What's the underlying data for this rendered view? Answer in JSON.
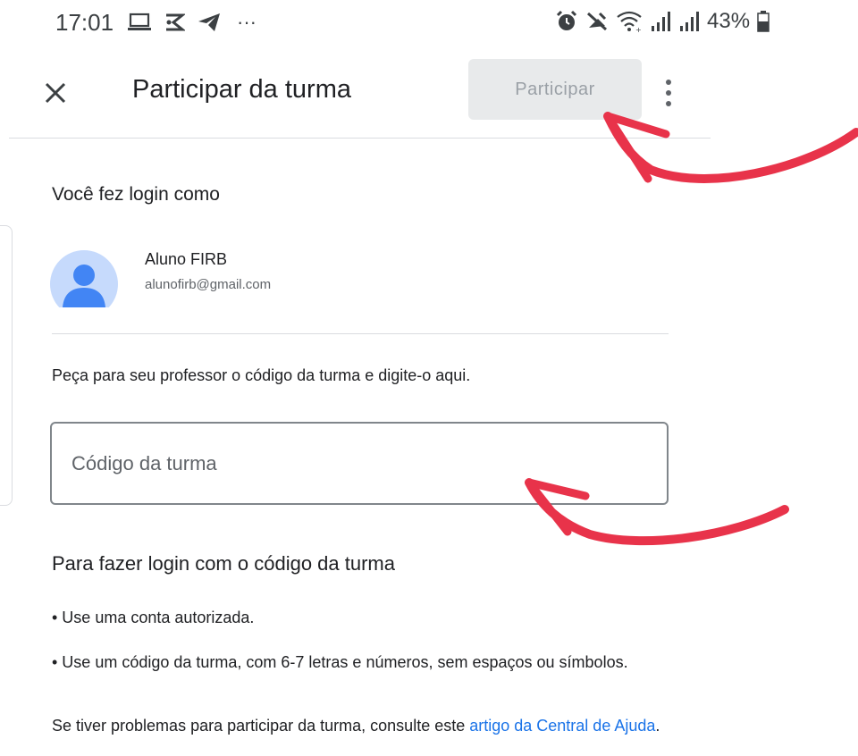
{
  "status_bar": {
    "time": "17:01",
    "left_icons": [
      "laptop-icon",
      "notification-icon",
      "telegram-icon",
      "more-notifications-icon"
    ],
    "overflow": "···",
    "right_icons": [
      "alarm-icon",
      "mute-icon",
      "wifi-icon",
      "signal-icon",
      "signal-icon"
    ],
    "battery": "43%"
  },
  "app_bar": {
    "close_icon": "close-icon",
    "title": "Participar da turma",
    "join_label": "Participar",
    "more_icon": "more-vert-icon"
  },
  "account_section": {
    "heading": "Você fez login como",
    "name": "Aluno FIRB",
    "email": "alunofirb@gmail.com",
    "avatar_icon": "person-icon"
  },
  "code_section": {
    "instruction": "Peça para seu professor o código da turma e digite-o aqui.",
    "input_placeholder": "Código da turma",
    "input_value": ""
  },
  "login_info": {
    "heading": "Para fazer login com o código da turma",
    "bullets": [
      "• Use uma conta autorizada.",
      "• Use um código da turma, com 6-7 letras e números, sem espaços ou símbolos."
    ],
    "help_prefix": "Se tiver problemas para participar da turma, consulte este ",
    "help_link": "artigo da Central de Ajuda",
    "help_suffix": "."
  },
  "colors": {
    "link": "#1a73e8",
    "annotation": "#e8334a",
    "disabled_button_bg": "#e8eaeb",
    "avatar_bg": "#c6dafc",
    "avatar_fg": "#4285f4"
  }
}
